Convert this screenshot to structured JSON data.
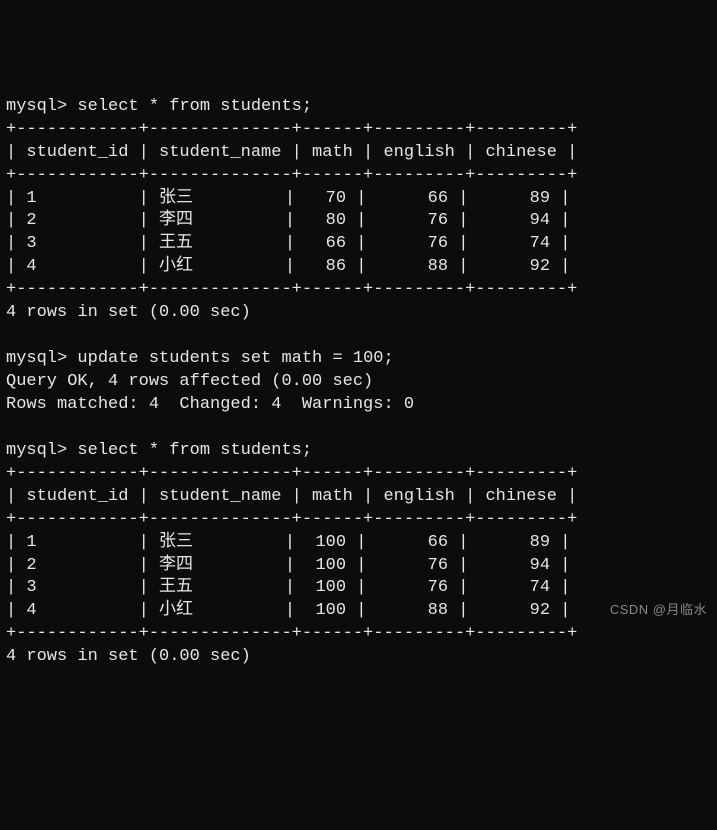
{
  "prompt": "mysql>",
  "queries": {
    "select": "select * from students;",
    "update": "update students set math = 100;"
  },
  "columns": [
    "student_id",
    "student_name",
    "math",
    "english",
    "chinese"
  ],
  "rows_before": [
    {
      "student_id": "1",
      "student_name": "张三",
      "math": "70",
      "english": "66",
      "chinese": "89"
    },
    {
      "student_id": "2",
      "student_name": "李四",
      "math": "80",
      "english": "76",
      "chinese": "94"
    },
    {
      "student_id": "3",
      "student_name": "王五",
      "math": "66",
      "english": "76",
      "chinese": "74"
    },
    {
      "student_id": "4",
      "student_name": "小红",
      "math": "86",
      "english": "88",
      "chinese": "92"
    }
  ],
  "rows_after": [
    {
      "student_id": "1",
      "student_name": "张三",
      "math": "100",
      "english": "66",
      "chinese": "89"
    },
    {
      "student_id": "2",
      "student_name": "李四",
      "math": "100",
      "english": "76",
      "chinese": "94"
    },
    {
      "student_id": "3",
      "student_name": "王五",
      "math": "100",
      "english": "76",
      "chinese": "74"
    },
    {
      "student_id": "4",
      "student_name": "小红",
      "math": "100",
      "english": "88",
      "chinese": "92"
    }
  ],
  "result_summary": "4 rows in set (0.00 sec)",
  "update_result": {
    "line1": "Query OK, 4 rows affected (0.00 sec)",
    "line2": "Rows matched: 4  Changed: 4  Warnings: 0"
  },
  "table_border": "+------------+--------------+------+---------+---------+",
  "header_row": "| student_id | student_name | math | english | chinese |",
  "watermark": "CSDN @月临水"
}
